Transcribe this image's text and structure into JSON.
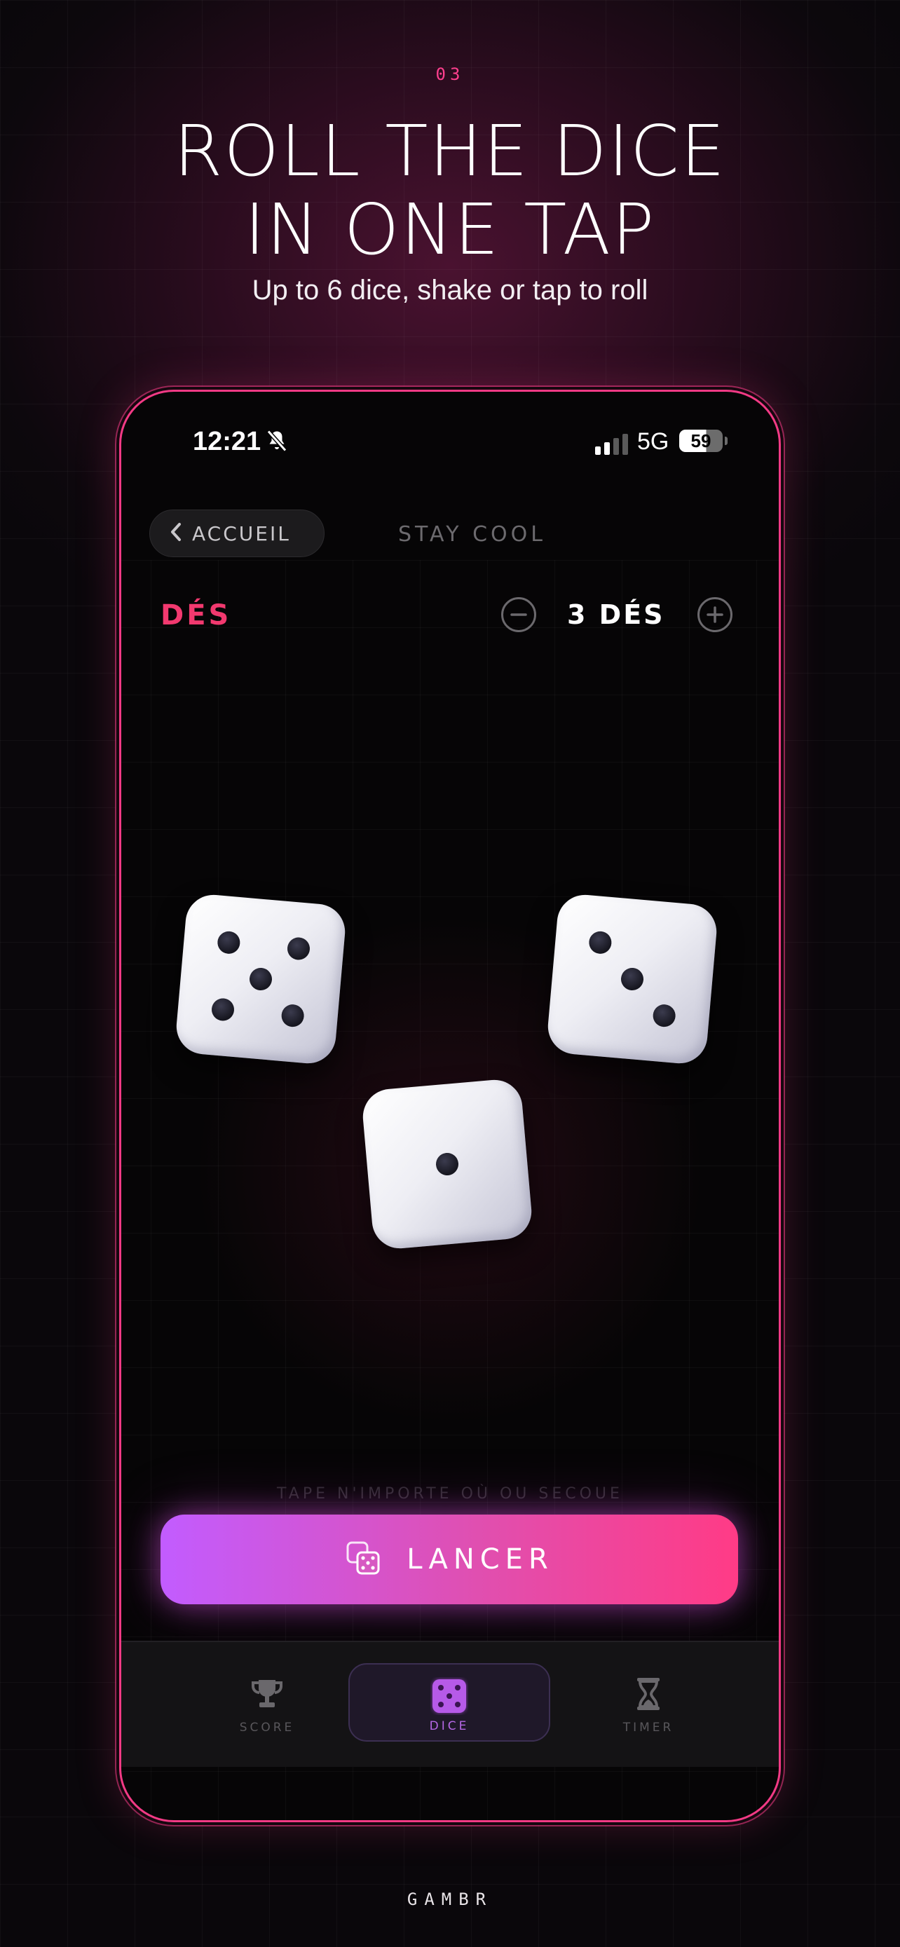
{
  "hero": {
    "step": "03",
    "headline_line1": "ROLL THE DICE",
    "headline_line2": "IN ONE TAP",
    "subtitle": "Up to 6 dice, shake or tap to roll"
  },
  "status_bar": {
    "time": "12:21",
    "network": "5G",
    "battery": "59"
  },
  "header": {
    "back_label": "ACCUEIL",
    "mood_label": "STAY COOL"
  },
  "dice_section": {
    "title": "DÉS",
    "count_label": "3 DÉS",
    "dice_values": [
      5,
      3,
      1
    ]
  },
  "hint": "TAPE N'IMPORTE OÙ OU SECOUE",
  "roll_button": {
    "label": "LANCER"
  },
  "tab_bar": {
    "tabs": [
      {
        "label": "SCORE",
        "icon": "trophy-icon",
        "active": false
      },
      {
        "label": "DICE",
        "icon": "dice-icon",
        "active": true
      },
      {
        "label": "TIMER",
        "icon": "hourglass-icon",
        "active": false
      }
    ]
  },
  "brand": "GAMBR",
  "colors": {
    "accent_pink": "#f2396f",
    "accent_purple": "#c25cff",
    "background": "#0a070b"
  }
}
